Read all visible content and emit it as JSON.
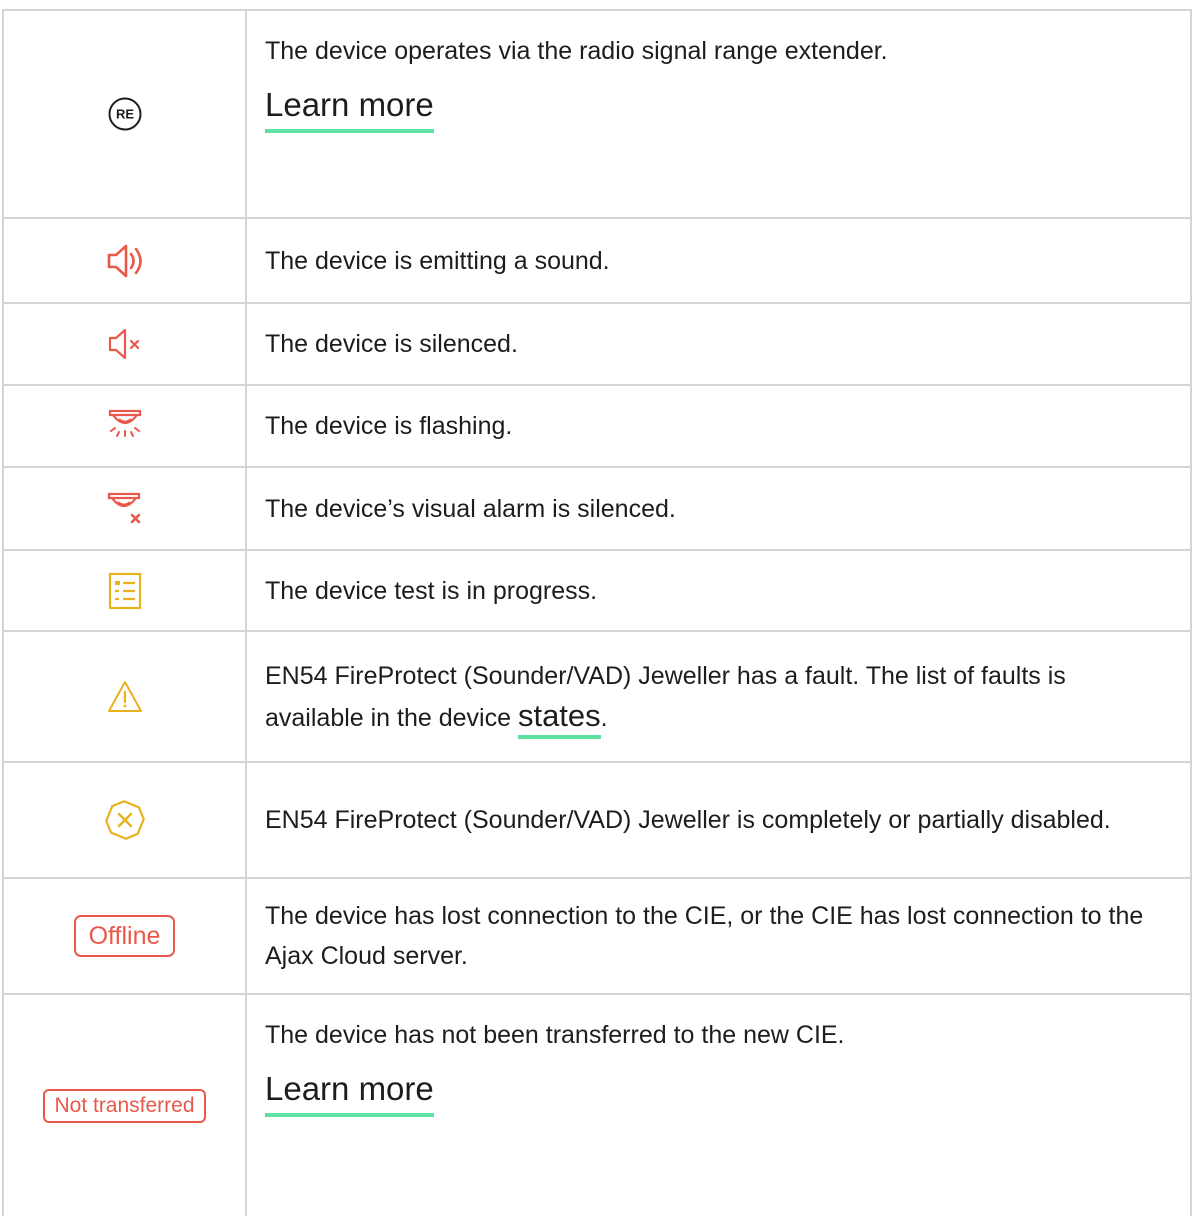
{
  "rows": [
    {
      "icon": "range-extender-icon",
      "icon_text": "RE",
      "text": "The device operates via the radio signal range extender.",
      "link": "Learn more"
    },
    {
      "icon": "speaker-sound-icon",
      "text": "The device is emitting a sound."
    },
    {
      "icon": "speaker-muted-icon",
      "text": "The device is silenced."
    },
    {
      "icon": "siren-flashing-icon",
      "text": "The device is flashing."
    },
    {
      "icon": "siren-visual-silenced-icon",
      "text": "The device’s visual alarm is silenced."
    },
    {
      "icon": "test-list-icon",
      "text": "The device test is in progress."
    },
    {
      "icon": "warning-triangle-icon",
      "text_before": "EN54 FireProtect (Sounder/VAD) Jeweller has a fault. The list of faults is available in the device ",
      "link": "states",
      "text_after": "."
    },
    {
      "icon": "disabled-octagon-icon",
      "text": "EN54 FireProtect (Sounder/VAD) Jeweller is completely or partially disabled."
    },
    {
      "badge": "Offline",
      "text": "The device has lost connection to the CIE, or the CIE has lost connection to the Ajax Cloud server."
    },
    {
      "badge": "Not transferred",
      "text": "The device has not been transferred to the new CIE.",
      "link": "Learn more"
    }
  ],
  "colors": {
    "red": "#e9594b",
    "yellow": "#e8b21e",
    "green_underline": "#5ce2a3",
    "border": "#d4d4d4"
  }
}
